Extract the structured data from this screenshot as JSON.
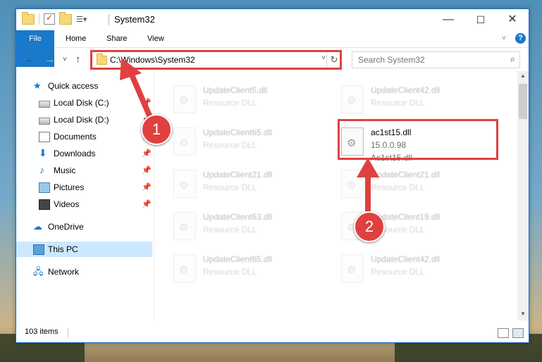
{
  "window": {
    "title": "System32",
    "controls": {
      "minimize": "—",
      "maximize": "☐",
      "close": "✕"
    }
  },
  "ribbon": {
    "tabs": [
      "File",
      "Home",
      "Share",
      "View"
    ],
    "expand_icon": "chevron-down-icon",
    "help_icon": "?"
  },
  "navigation": {
    "address": "C:\\Windows\\System32",
    "search_placeholder": "Search System32"
  },
  "nav_pane": {
    "items": [
      {
        "label": "Quick access",
        "icon": "star-icon"
      },
      {
        "label": "Local Disk (C:)",
        "icon": "drive-icon",
        "pinned": true
      },
      {
        "label": "Local Disk (D:)",
        "icon": "drive-icon",
        "pinned": true
      },
      {
        "label": "Documents",
        "icon": "documents-icon",
        "pinned": true
      },
      {
        "label": "Downloads",
        "icon": "downloads-icon",
        "pinned": true
      },
      {
        "label": "Music",
        "icon": "music-icon",
        "pinned": true
      },
      {
        "label": "Pictures",
        "icon": "pictures-icon",
        "pinned": true
      },
      {
        "label": "Videos",
        "icon": "videos-icon",
        "pinned": true
      },
      {
        "label": "OneDrive",
        "icon": "cloud-icon"
      },
      {
        "label": "This PC",
        "icon": "computer-icon",
        "selected": true
      },
      {
        "label": "Network",
        "icon": "network-icon"
      }
    ]
  },
  "files": [
    {
      "name": "UpdateClient5.dll",
      "type": "Resource DLL"
    },
    {
      "name": "UpdateClient42.dll",
      "type": "Resource DLL"
    },
    {
      "name": "UpdateClient65.dll",
      "type": "Resource DLL"
    },
    {
      "name": "ac1st15.dll",
      "version": "15.0.0.98",
      "description": "Ac1st15.dll",
      "highlighted": true
    },
    {
      "name": "UpdateClient21.dll",
      "type": "Resource DLL"
    },
    {
      "name": "UpdateClient21.dll",
      "type": "Resource DLL"
    },
    {
      "name": "UpdateClient63.dll",
      "type": "Resource DLL"
    },
    {
      "name": "UpdateClient19.dll",
      "type": "Resource DLL"
    },
    {
      "name": "UpdateClient65.dll",
      "type": "Resource DLL"
    },
    {
      "name": "UpdateClient42.dll",
      "type": "Resource DLL"
    }
  ],
  "status": {
    "item_count": "103 items"
  },
  "callouts": [
    {
      "number": "1",
      "target": "address-bar"
    },
    {
      "number": "2",
      "target": "ac1st15.dll"
    }
  ],
  "colors": {
    "accent": "#1979ca",
    "highlight": "#e04040",
    "selection": "#cce8ff"
  }
}
